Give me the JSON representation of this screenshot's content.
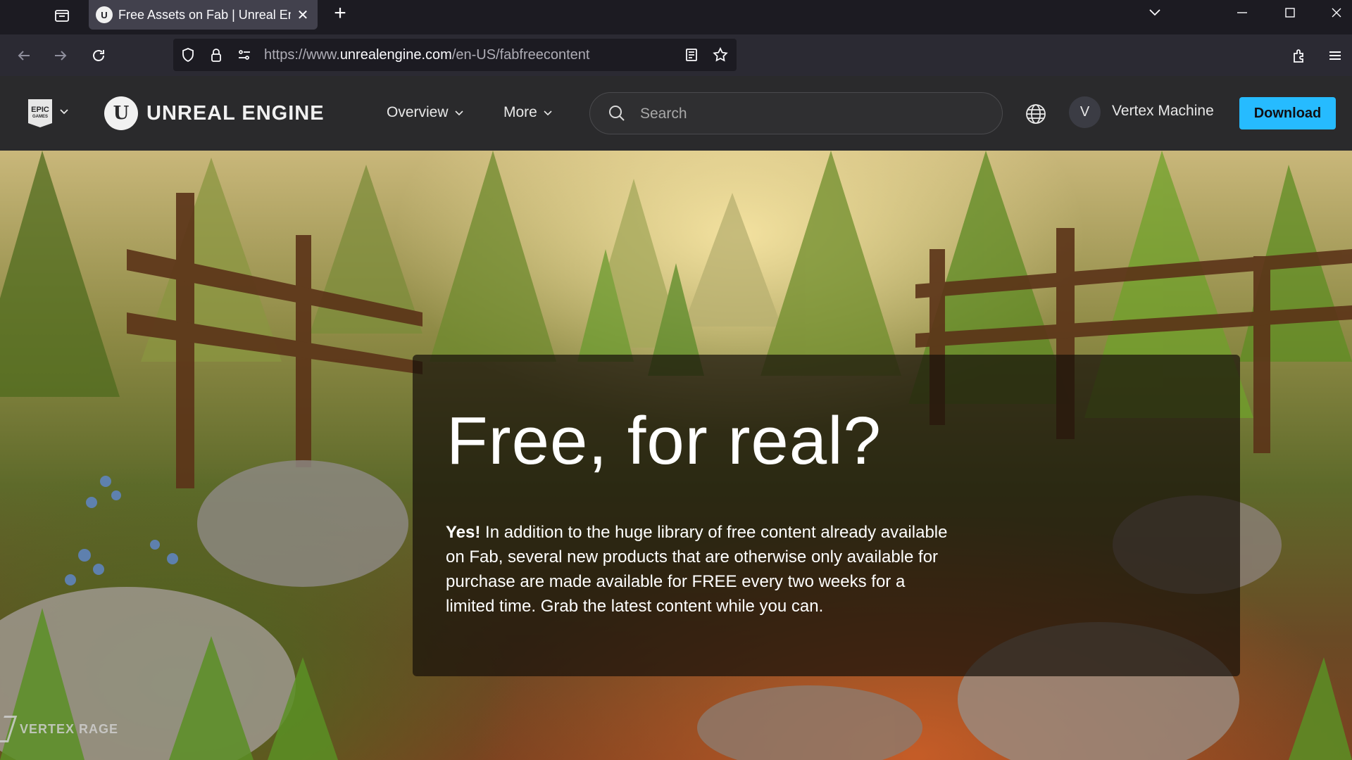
{
  "browser": {
    "tab": {
      "favicon": "unreal-engine-favicon",
      "title": "Free Assets on Fab | Unreal Engine",
      "close": "✕"
    },
    "new_tab": "+",
    "url": {
      "scheme": "https://www.",
      "host": "unrealengine.com",
      "path": "/en-US/fabfreecontent"
    }
  },
  "site": {
    "epic_logo": {
      "line1": "EPIC",
      "line2": "GAMES"
    },
    "brand": {
      "mark": "U",
      "wordmark": "UNREAL ENGINE"
    },
    "menu": [
      {
        "label": "Overview"
      },
      {
        "label": "More"
      }
    ],
    "search": {
      "placeholder": "Search"
    },
    "user": {
      "initial": "V",
      "name": "Vertex Machine"
    },
    "download_label": "Download"
  },
  "hero": {
    "title": "Free, for real?",
    "body_lead": "Yes!",
    "body": " In addition to the huge library of free content already available on Fab, several new products that are otherwise only available for purchase are made available for FREE every two weeks for a limited time. Grab the latest content while you can.",
    "watermark": "VERTEX RAGE"
  },
  "colors": {
    "accent": "#26bbff",
    "header_bg": "#2a2a2c",
    "browser_bg": "#1c1b22"
  }
}
